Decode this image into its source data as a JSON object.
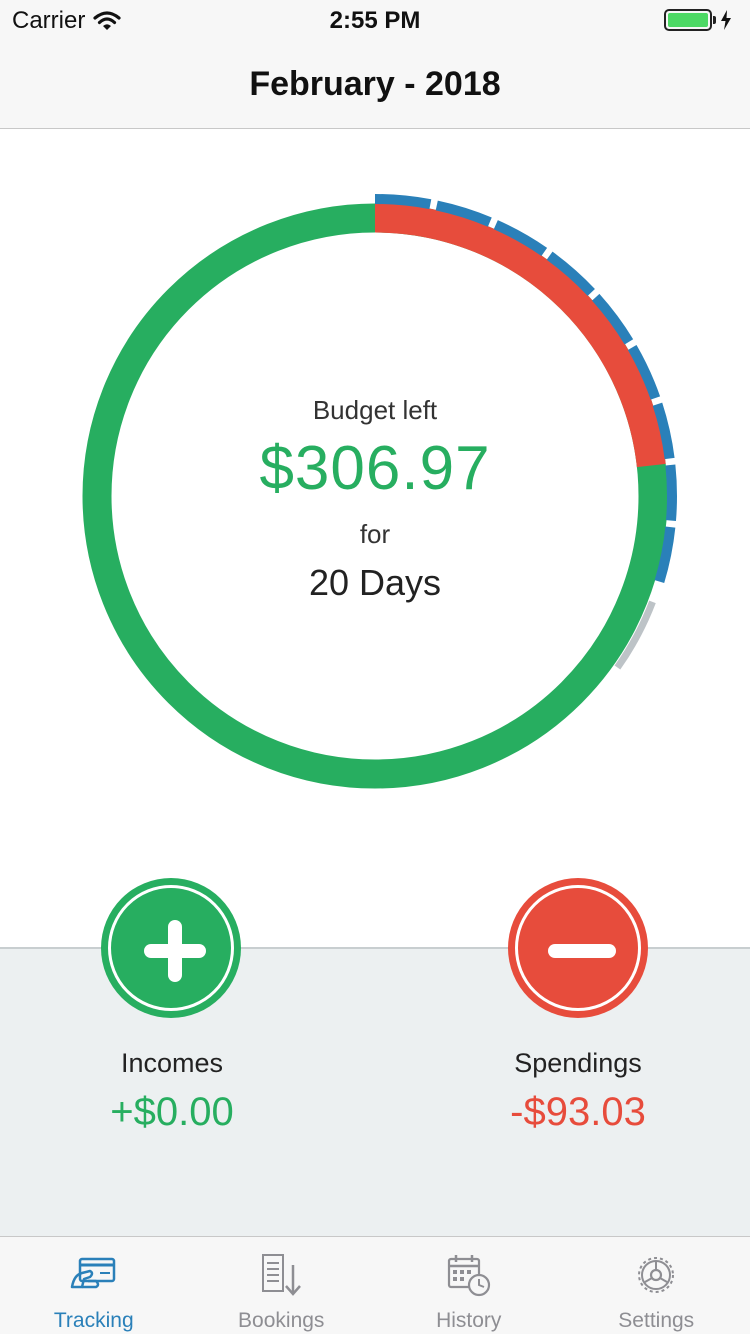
{
  "status_bar": {
    "carrier": "Carrier",
    "time": "2:55 PM"
  },
  "nav": {
    "title": "February - 2018"
  },
  "budget": {
    "label": "Budget left",
    "amount": "$306.97",
    "for_label": "for",
    "days": "20 Days",
    "spent_fraction": 0.2325,
    "days_elapsed_fraction": 0.3,
    "days_remaining_marker_fraction": 0.04
  },
  "actions": {
    "income": {
      "label": "Incomes",
      "value": "+$0.00"
    },
    "spending": {
      "label": "Spendings",
      "value": "-$93.03"
    }
  },
  "tabs": [
    {
      "label": "Tracking",
      "icon": "credit-card-icon",
      "active": true
    },
    {
      "label": "Bookings",
      "icon": "list-sort-icon",
      "active": false
    },
    {
      "label": "History",
      "icon": "calendar-clock-icon",
      "active": false
    },
    {
      "label": "Settings",
      "icon": "gear-icon",
      "active": false
    }
  ],
  "colors": {
    "green": "#27ae60",
    "red": "#e74c3c",
    "blue": "#2a80b9",
    "gray": "#bdc3c7",
    "panel": "#ecf0f1"
  }
}
